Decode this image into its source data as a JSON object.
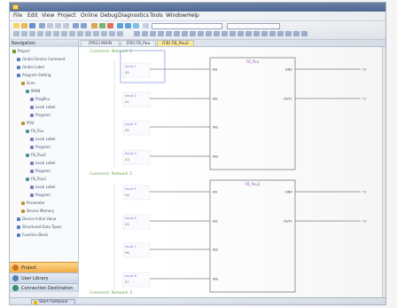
{
  "window": {
    "title": ""
  },
  "menu": [
    "File",
    "Edit",
    "View",
    "Project",
    "Online",
    "Debug",
    "Diagnostics",
    "Tools",
    "Window",
    "Help"
  ],
  "toolbar": {
    "dropdown1": "",
    "dropdown2": ""
  },
  "left_panel": {
    "header": "Navigation",
    "tree_items": [
      {
        "level": 0,
        "label": "Project"
      },
      {
        "level": 1,
        "label": "Global Device Comment"
      },
      {
        "level": 1,
        "label": "Global Label"
      },
      {
        "level": 1,
        "label": "Program Setting"
      },
      {
        "level": 2,
        "label": "Scan"
      },
      {
        "level": 3,
        "label": "MAIN"
      },
      {
        "level": 4,
        "label": "ProgPou"
      },
      {
        "level": 4,
        "label": "Local Label"
      },
      {
        "level": 4,
        "label": "Program"
      },
      {
        "level": 2,
        "label": "POU"
      },
      {
        "level": 3,
        "label": "FB_Pou"
      },
      {
        "level": 4,
        "label": "Local Label"
      },
      {
        "level": 4,
        "label": "Program"
      },
      {
        "level": 3,
        "label": "FB_Pou2"
      },
      {
        "level": 4,
        "label": "Local Label"
      },
      {
        "level": 4,
        "label": "Program"
      },
      {
        "level": 3,
        "label": "FB_Pou3"
      },
      {
        "level": 4,
        "label": "Local Label"
      },
      {
        "level": 4,
        "label": "Program"
      },
      {
        "level": 2,
        "label": "Parameter"
      },
      {
        "level": 2,
        "label": "Device Memory"
      },
      {
        "level": 1,
        "label": "Device Initial Value"
      },
      {
        "level": 1,
        "label": "Structured Data Types"
      },
      {
        "level": 1,
        "label": "Function Block"
      }
    ],
    "nav_buttons": [
      {
        "label": "Project",
        "active": true
      },
      {
        "label": "User Library",
        "active": false
      },
      {
        "label": "Connection Destination",
        "active": false
      }
    ]
  },
  "tabs": [
    {
      "label": "[PRG] MAIN",
      "active": false
    },
    {
      "label": "[FB] FB_Pou",
      "active": false
    },
    {
      "label": "[FB] FB_Pou2",
      "active": true
    }
  ],
  "diagram": {
    "blocks": [
      {
        "comment": "Comment: Network 1",
        "inputs": [
          {
            "var": "Input 1",
            "tag": "X0"
          },
          {
            "var": "Input 2",
            "tag": "X1"
          },
          {
            "var": "Input 3",
            "tag": "X2"
          },
          {
            "var": "Input 4",
            "tag": "X3"
          }
        ],
        "block_name": "FB_Pou",
        "pins_in": [
          "EN",
          "IN1",
          "IN2",
          "IN3"
        ],
        "pins_out": [
          "ENO",
          "OUT1"
        ],
        "outputs": [
          "Y0",
          "Y1"
        ]
      },
      {
        "comment": "Comment: Network 2",
        "inputs": [
          {
            "var": "Input 5",
            "tag": "X4"
          },
          {
            "var": "Input 6",
            "tag": "X5"
          },
          {
            "var": "Input 7",
            "tag": "X6"
          },
          {
            "var": "Input 8",
            "tag": "X7"
          }
        ],
        "block_name": "FB_Pou2",
        "pins_in": [
          "EN",
          "IN1",
          "IN2",
          "IN3"
        ],
        "pins_out": [
          "ENO",
          "OUT1"
        ],
        "outputs": [
          "Y2",
          "Y3"
        ]
      }
    ],
    "footer_comment": "Comment: Network 3"
  },
  "statusbar": {
    "start_label": "Start Fishbone"
  }
}
